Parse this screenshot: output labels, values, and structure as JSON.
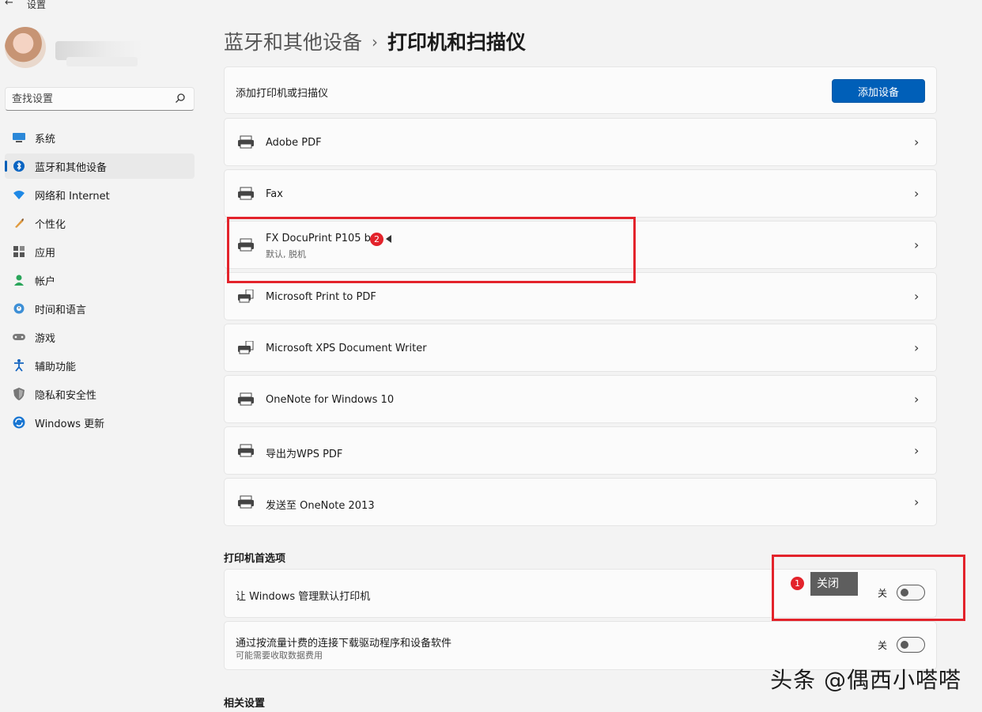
{
  "window": {
    "back_glyph": "←",
    "title": "设置"
  },
  "search": {
    "placeholder": "查找设置"
  },
  "sidebar": {
    "items": [
      {
        "label": "系统",
        "icon": "system-icon",
        "active": false
      },
      {
        "label": "蓝牙和其他设备",
        "icon": "bluetooth-icon",
        "active": true
      },
      {
        "label": "网络和 Internet",
        "icon": "wifi-icon",
        "active": false
      },
      {
        "label": "个性化",
        "icon": "brush-icon",
        "active": false
      },
      {
        "label": "应用",
        "icon": "apps-icon",
        "active": false
      },
      {
        "label": "帐户",
        "icon": "account-icon",
        "active": false
      },
      {
        "label": "时间和语言",
        "icon": "globe-clock-icon",
        "active": false
      },
      {
        "label": "游戏",
        "icon": "gamepad-icon",
        "active": false
      },
      {
        "label": "辅助功能",
        "icon": "accessibility-icon",
        "active": false
      },
      {
        "label": "隐私和安全性",
        "icon": "shield-icon",
        "active": false
      },
      {
        "label": "Windows 更新",
        "icon": "update-icon",
        "active": false
      }
    ]
  },
  "breadcrumb": {
    "parent": "蓝牙和其他设备",
    "separator": "›",
    "current": "打印机和扫描仪"
  },
  "add_row": {
    "label": "添加打印机或扫描仪",
    "button": "添加设备"
  },
  "printers": [
    {
      "name": "Adobe PDF",
      "sub": ""
    },
    {
      "name": "Fax",
      "sub": ""
    },
    {
      "name": "FX DocuPrint P105 b",
      "sub": "默认, 脱机"
    },
    {
      "name": "Microsoft Print to PDF",
      "sub": ""
    },
    {
      "name": "Microsoft XPS Document Writer",
      "sub": ""
    },
    {
      "name": "OneNote for Windows 10",
      "sub": ""
    },
    {
      "name": "导出为WPS PDF",
      "sub": ""
    },
    {
      "name": "发送至 OneNote 2013",
      "sub": ""
    }
  ],
  "preferences": {
    "title": "打印机首选项",
    "items": [
      {
        "label": "让 Windows 管理默认打印机",
        "sub": "",
        "state": "关"
      },
      {
        "label": "通过按流量计费的连接下载驱动程序和设备软件",
        "sub": "可能需要收取数据费用",
        "state": "关"
      }
    ]
  },
  "related": {
    "title": "相关设置"
  },
  "annotations": {
    "badge1": "1",
    "badge2": "2",
    "tooltip": "关闭",
    "color": "#e3232b"
  },
  "watermark": "头条 @偶西小嗒嗒",
  "colors": {
    "accent": "#005fb8",
    "background": "#f3f3f3",
    "card": "#fbfbfb"
  }
}
